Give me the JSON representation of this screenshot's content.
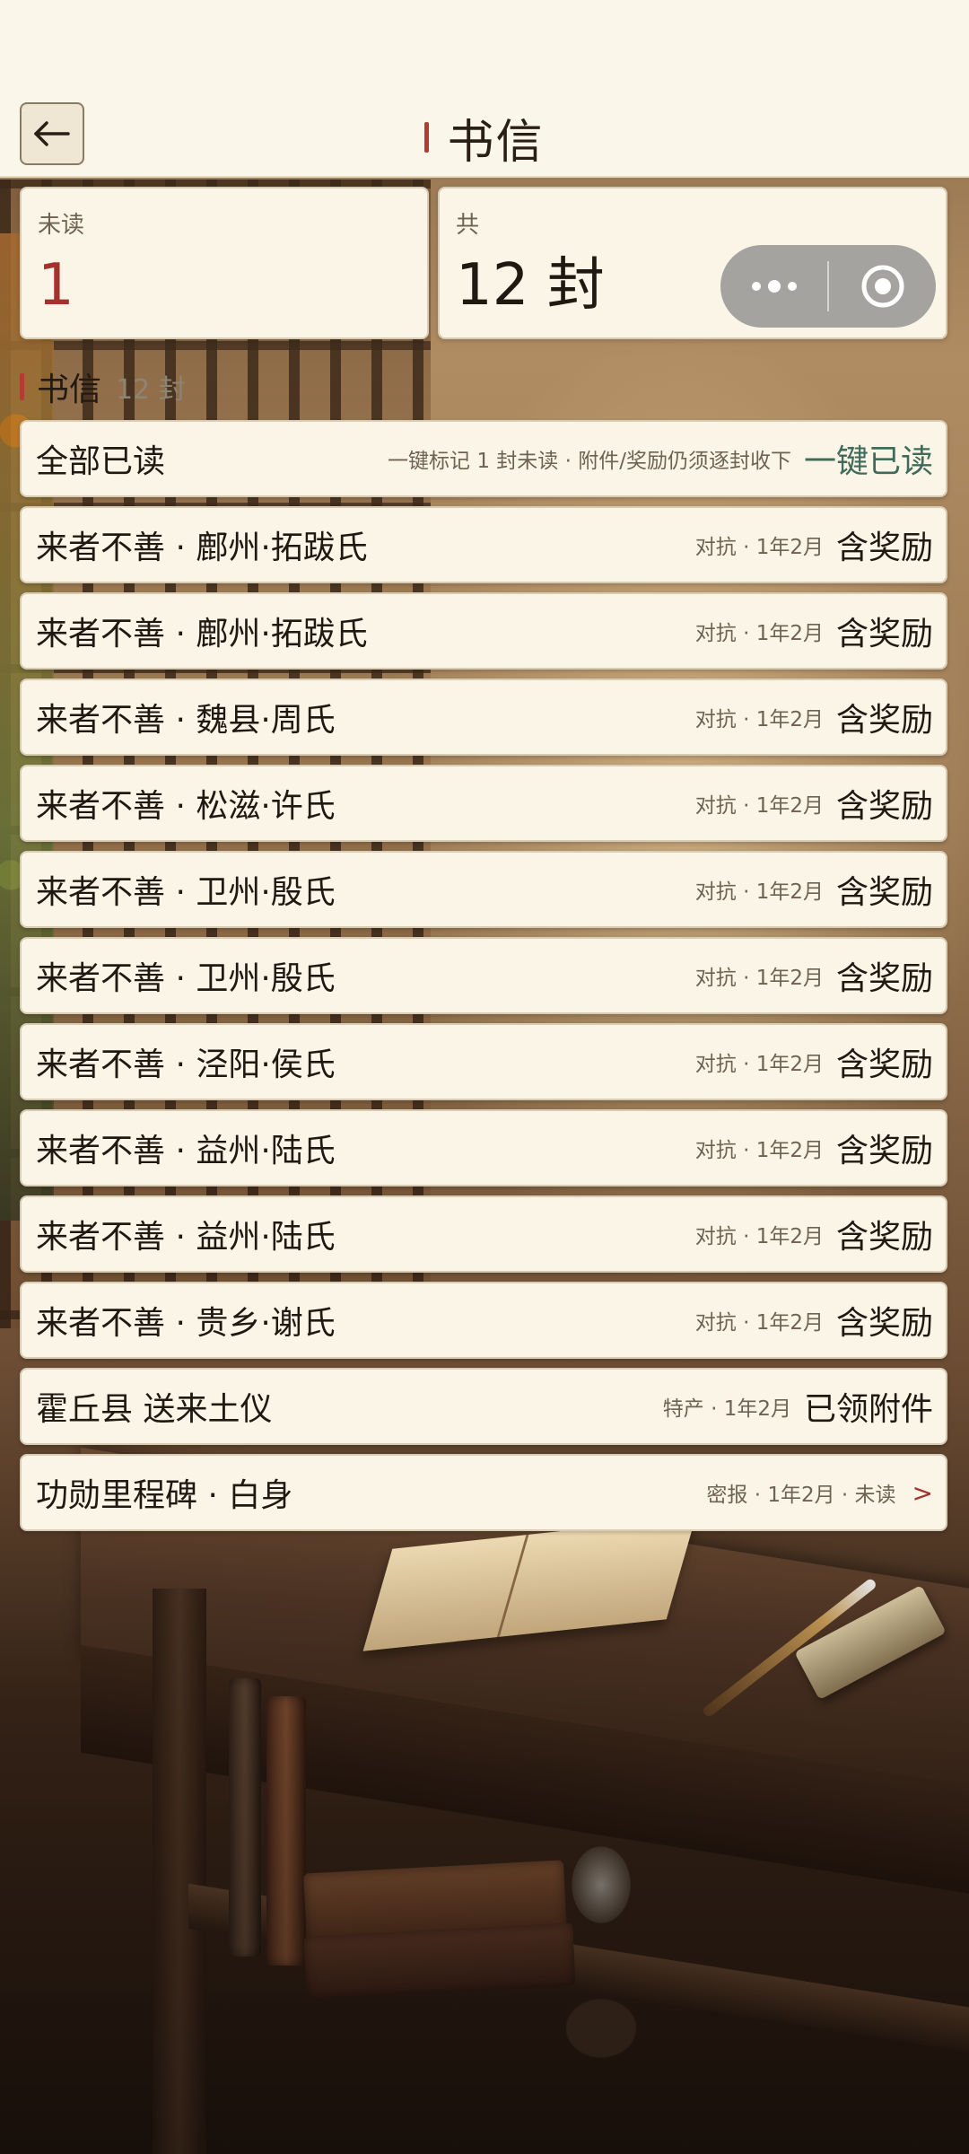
{
  "header": {
    "title": "书信",
    "back_icon": "arrow-left-icon"
  },
  "stats": {
    "unread_label": "未读",
    "unread_value": "1",
    "total_label": "共",
    "total_value": "12 封"
  },
  "capsule": {
    "more_icon": "more-dots-icon",
    "close_icon": "target-close-icon"
  },
  "section": {
    "title": "书信",
    "count": "12 封"
  },
  "mark_all": {
    "title": "全部已读",
    "hint": "一键标记 1 封未读 · 附件/奖励仍须逐封收下",
    "button": "一键已读"
  },
  "letters": [
    {
      "title": "来者不善 · 鄜州·拓跋氏",
      "meta": "对抗 · 1年2月",
      "tag": "含奖励"
    },
    {
      "title": "来者不善 · 鄜州·拓跋氏",
      "meta": "对抗 · 1年2月",
      "tag": "含奖励"
    },
    {
      "title": "来者不善 · 魏县·周氏",
      "meta": "对抗 · 1年2月",
      "tag": "含奖励"
    },
    {
      "title": "来者不善 · 松滋·许氏",
      "meta": "对抗 · 1年2月",
      "tag": "含奖励"
    },
    {
      "title": "来者不善 · 卫州·殷氏",
      "meta": "对抗 · 1年2月",
      "tag": "含奖励"
    },
    {
      "title": "来者不善 · 卫州·殷氏",
      "meta": "对抗 · 1年2月",
      "tag": "含奖励"
    },
    {
      "title": "来者不善 · 泾阳·侯氏",
      "meta": "对抗 · 1年2月",
      "tag": "含奖励"
    },
    {
      "title": "来者不善 · 益州·陆氏",
      "meta": "对抗 · 1年2月",
      "tag": "含奖励"
    },
    {
      "title": "来者不善 · 益州·陆氏",
      "meta": "对抗 · 1年2月",
      "tag": "含奖励"
    },
    {
      "title": "来者不善 · 贵乡·谢氏",
      "meta": "对抗 · 1年2月",
      "tag": "含奖励"
    },
    {
      "title": "霍丘县 送来土仪",
      "meta": "特产 · 1年2月",
      "tag": "已领附件"
    },
    {
      "title": "功勋里程碑 · 白身",
      "meta": "密报 · 1年2月 · 未读",
      "tag": ">"
    }
  ],
  "colors": {
    "accent_red": "#a3312d",
    "accent_green": "#3f6b5a",
    "card_bg": "#fbf5e8",
    "header_bg": "#fbf6ea"
  }
}
